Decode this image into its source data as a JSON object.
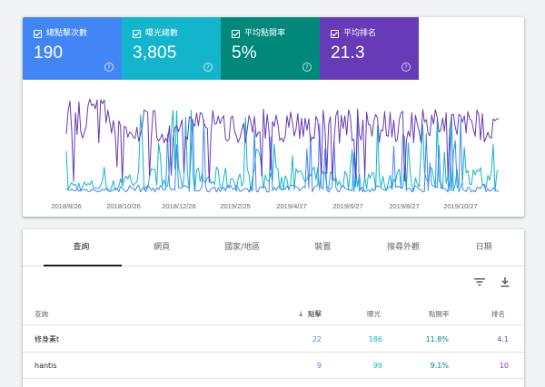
{
  "metrics": [
    {
      "label": "總點擊次數",
      "value": "190",
      "color": "#4285f4"
    },
    {
      "label": "曝光總數",
      "value": "3,805",
      "color": "#12b5cb"
    },
    {
      "label": "平均點閱率",
      "value": "5%",
      "color": "#00897b"
    },
    {
      "label": "平均排名",
      "value": "21.3",
      "color": "#673ab7"
    }
  ],
  "help_glyph": "?",
  "chart_data": {
    "type": "line",
    "x_tick_labels": [
      "2018/8/26",
      "2018/10/26",
      "2018/12/26",
      "2019/2/25",
      "2019/4/27",
      "2019/6/27",
      "2019/8/27",
      "2019/10/27"
    ],
    "x_range": [
      "2018-08-06",
      "2019-12-15"
    ],
    "y_axis_labels_shown": false,
    "gridlines": false,
    "series": [
      {
        "name": "平均排名",
        "color": "#673ab7",
        "scale": "inverted",
        "description": "mostly 10-30, noisy daily"
      },
      {
        "name": "曝光總數",
        "color": "#12b5cb",
        "description": "daily impressions, mostly low with spikes"
      },
      {
        "name": "總點擊次數",
        "color": "#4285f4",
        "description": "daily clicks, mostly 0-2 with spikes"
      }
    ]
  },
  "tabs": [
    "查詢",
    "網頁",
    "國家/地區",
    "裝置",
    "搜尋外觀",
    "日期"
  ],
  "table": {
    "headers": {
      "query": "查詢",
      "clicks": "點擊",
      "impressions": "曝光",
      "ctr": "點閱率",
      "position": "排名"
    },
    "sort_arrow": "↓",
    "rows": [
      {
        "query": "修身素t",
        "clicks": "22",
        "impressions": "186",
        "ctr": "11.8%",
        "position": "4.1"
      },
      {
        "query": "hantis",
        "clicks": "9",
        "impressions": "99",
        "ctr": "9.1%",
        "position": "10"
      }
    ]
  }
}
